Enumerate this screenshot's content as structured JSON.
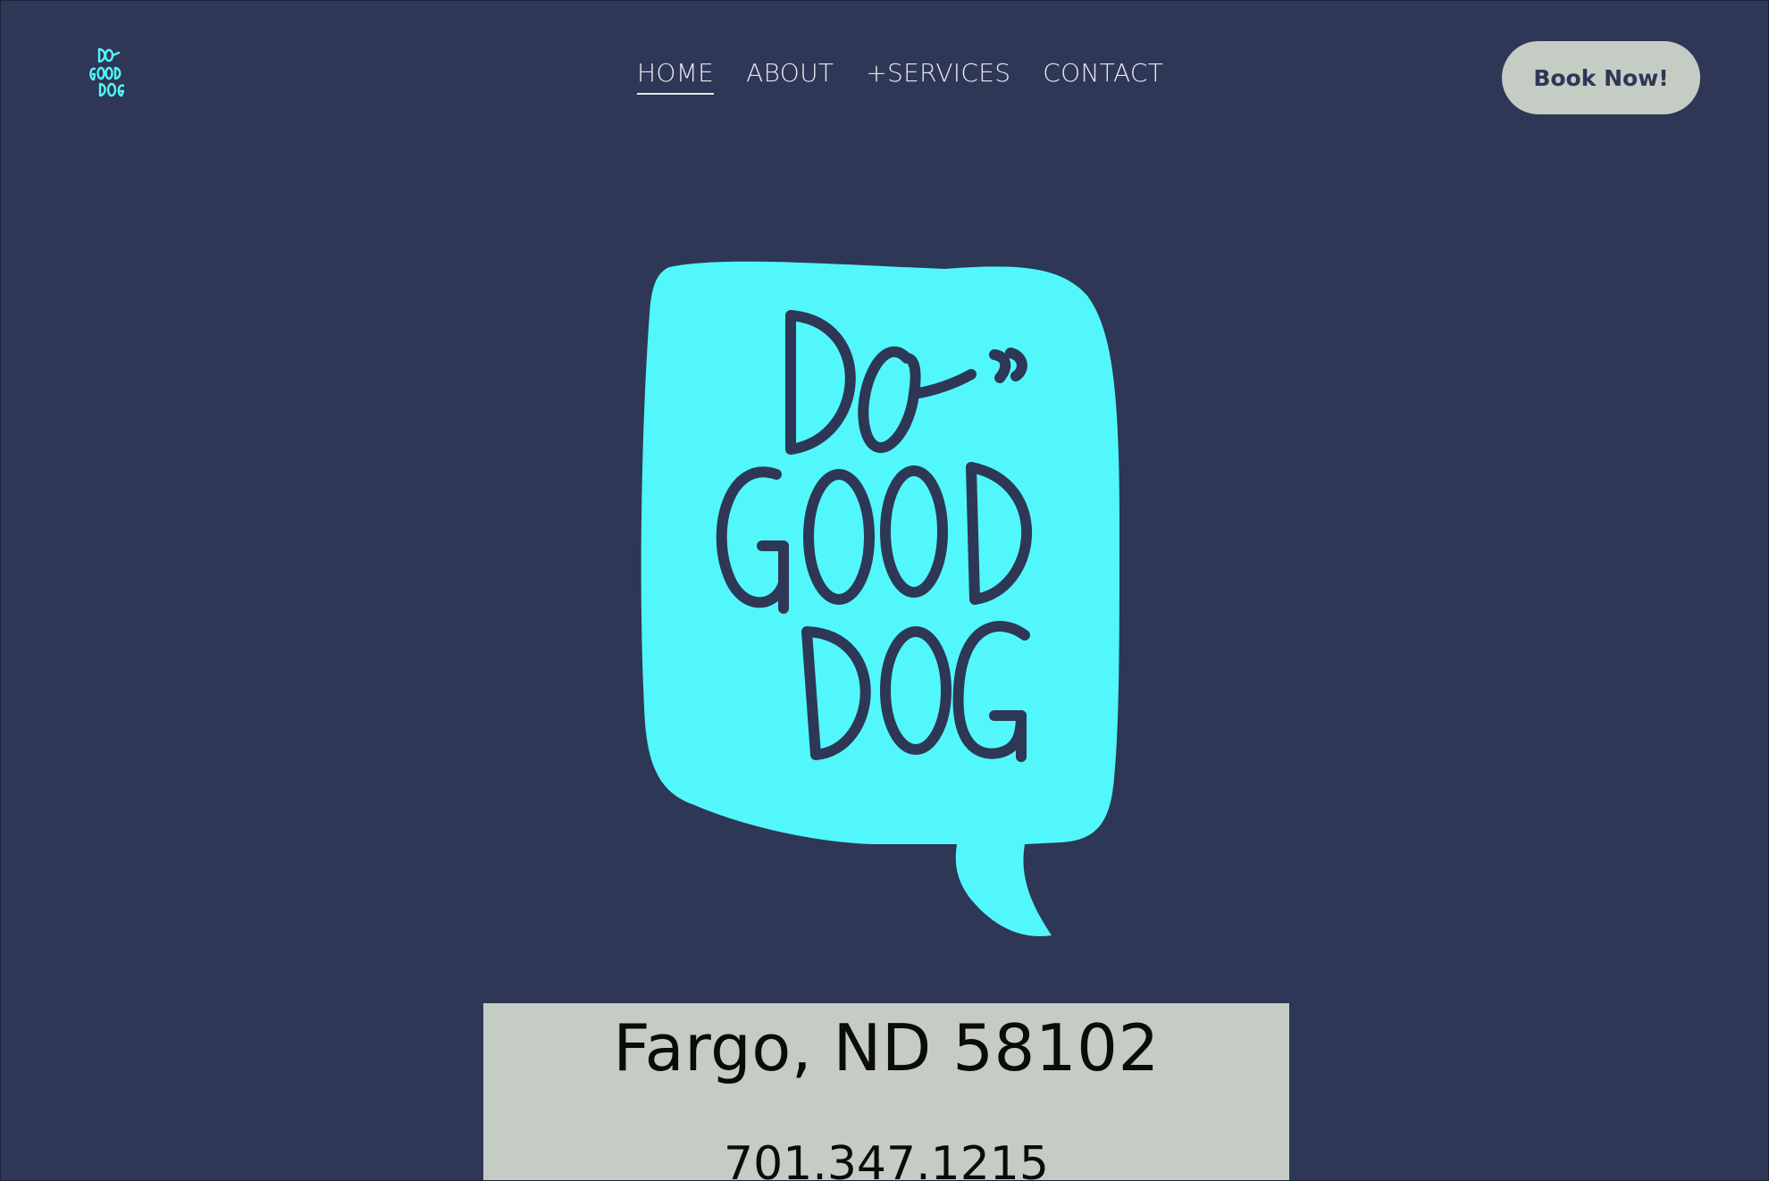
{
  "brand": {
    "logo_text_lines": [
      "DO",
      "GOOD",
      "DOG"
    ],
    "logo_color": "#52f7fb",
    "logo_ink_color": "#2e3756"
  },
  "nav": {
    "items": [
      {
        "label": "HOME",
        "active": true
      },
      {
        "label": "ABOUT",
        "active": false
      },
      {
        "label": "+SERVICES",
        "active": false
      },
      {
        "label": "CONTACT",
        "active": false
      }
    ]
  },
  "header": {
    "cta_label": "Book Now!"
  },
  "info": {
    "location": "Fargo, ND 58102",
    "phone": "701.347.1215"
  },
  "colors": {
    "background": "#2e3756",
    "accent_cyan": "#52f7fb",
    "sage": "#c5ccc3",
    "nav_text": "#e6e8ee"
  }
}
